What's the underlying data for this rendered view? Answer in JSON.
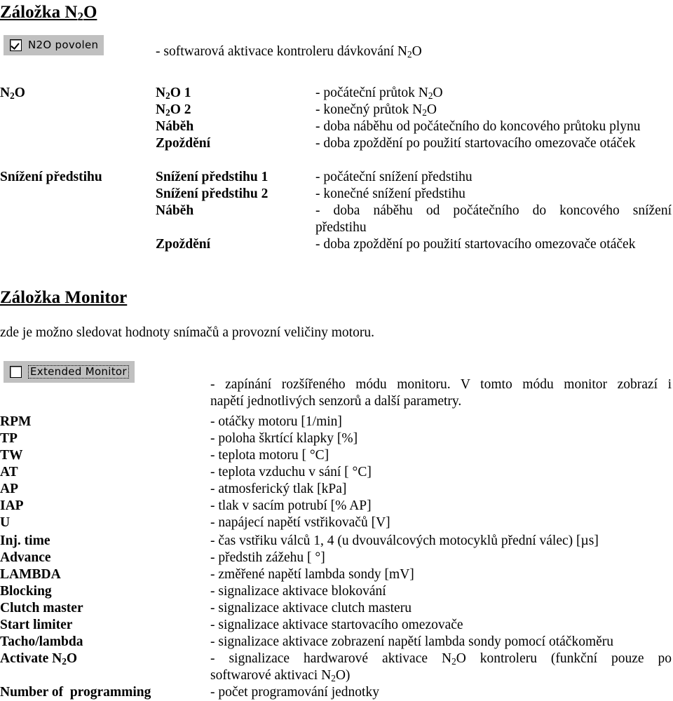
{
  "document": {
    "sections": [
      {
        "heading_prefix": "Záložka N",
        "heading_sub": "2",
        "heading_suffix": "O"
      }
    ]
  },
  "section_n2o": {
    "heading": {
      "prefix": "Záložka N",
      "sub": "2",
      "suffix": "O"
    },
    "checkbox": {
      "label": "N2O povolen",
      "checked": "true"
    },
    "checkbox_description": {
      "prefix": "- softwarová aktivace kontroleru dávkování N",
      "sub": "2",
      "suffix": "O"
    },
    "group_label": {
      "prefix": "N",
      "sub": "2",
      "suffix": "O"
    },
    "rows": [
      {
        "param_prefix": "N",
        "param_sub": "2",
        "param_suffix": "O 1",
        "desc_prefix": "- počáteční průtok N",
        "desc_sub": "2",
        "desc_suffix": "O"
      },
      {
        "param_prefix": "N",
        "param_sub": "2",
        "param_suffix": "O 2",
        "desc_prefix": "- konečný průtok N",
        "desc_sub": "2",
        "desc_suffix": "O"
      },
      {
        "param": "Náběh",
        "desc": "- doba náběhu od počátečního do koncového průtoku plynu"
      },
      {
        "param": "Zpoždění",
        "desc": "- doba zpoždění po použití startovacího omezovače otáček"
      }
    ]
  },
  "section_predstih": {
    "group_label": "Snížení předstihu",
    "rows": [
      {
        "param": "Snížení předstihu 1",
        "desc": "- počáteční snížení předstihu"
      },
      {
        "param": "Snížení předstihu 2",
        "desc": "- konečné snížení předstihu"
      },
      {
        "param": "Náběh",
        "desc_line1": "- doba náběhu od počátečního do koncového snížení",
        "desc_line2": "předstihu"
      },
      {
        "param": "Zpoždění",
        "desc": "- doba zpoždění po použití startovacího omezovače otáček"
      }
    ]
  },
  "section_monitor": {
    "heading": "Záložka Monitor",
    "intro": "zde je možno sledovat hodnoty snímačů a provozní veličiny motoru.",
    "checkbox": {
      "label": "Extended Monitor",
      "checked": "false"
    },
    "checkbox_description_line1": "- zapínání rozšířeného módu monitoru. V tomto módu monitor zobrazí i",
    "checkbox_description_line2": "napětí jednotlivých senzorů a další parametry.",
    "rows": [
      {
        "param": "RPM",
        "desc": "- otáčky motoru [1/min]"
      },
      {
        "param": "TP",
        "desc": "- poloha škrtící klapky [%]"
      },
      {
        "param": "TW",
        "desc": "- teplota motoru [ °C]"
      },
      {
        "param": "AT",
        "desc": "- teplota vzduchu v sání [ °C]"
      },
      {
        "param": "AP",
        "desc": "- atmosferický tlak [kPa]"
      },
      {
        "param": "IAP",
        "desc": "- tlak v sacím potrubí [% AP]"
      },
      {
        "param": "U",
        "desc": "- napájecí napětí vstřikovačů [V]"
      },
      {
        "param": "Inj. time",
        "desc": "- čas vstřiku válců 1, 4 (u dvouválcových motocyklů přední válec) [µs]"
      },
      {
        "param": "Advance",
        "desc": "- předstih zážehu [ °]"
      },
      {
        "param": "LAMBDA",
        "desc": "- změřené napětí lambda sondy [mV]"
      },
      {
        "param": "Blocking",
        "desc": "- signalizace aktivace blokování"
      },
      {
        "param": "Clutch master",
        "desc": "- signalizace aktivace clutch masteru"
      },
      {
        "param": "Start limiter",
        "desc": "- signalizace aktivace startovacího omezovače"
      },
      {
        "param": "Tacho/lambda",
        "desc": "- signalizace aktivace zobrazení napětí lambda sondy pomocí otáčkoměru"
      }
    ],
    "activate_row": {
      "param_prefix": "Activate N",
      "param_sub": "2",
      "param_suffix": "O",
      "desc_line1_prefix": "- signalizace hardwarové aktivace N",
      "desc_line1_sub": "2",
      "desc_line1_suffix": "O kontroleru (funkční pouze po",
      "desc_line2_prefix": "softwarové aktivaci N",
      "desc_line2_sub": "2",
      "desc_line2_suffix": "O)"
    },
    "last_row": {
      "param": "Number of  programming",
      "desc": "- počet programování jednotky"
    }
  }
}
